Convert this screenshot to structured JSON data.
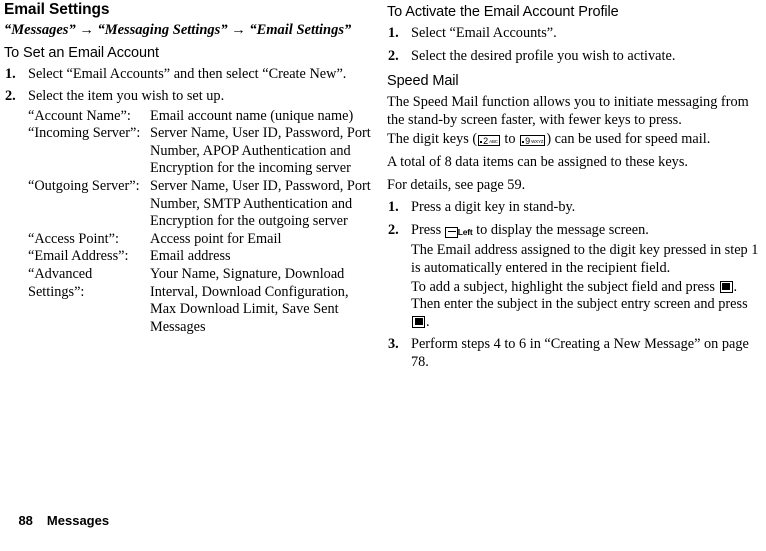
{
  "left_column": {
    "page_title": "Email Settings",
    "breadcrumb": "“Messages” → “Messaging Settings” → “Email Settings”",
    "section_heading": "To Set an Email Account",
    "steps": [
      {
        "num": "1.",
        "text": "Select “Email Accounts” and then select “Create New”."
      },
      {
        "num": "2.",
        "text": "Select the item you wish to set up."
      }
    ],
    "definitions": [
      {
        "term": "“Account Name”:",
        "desc": "Email account name (unique name)"
      },
      {
        "term": "“Incoming Server”:",
        "desc": "Server Name, User ID, Password, Port Number, APOP Authentication and Encryption for the incoming server"
      },
      {
        "term": "“Outgoing Server”:",
        "desc": "Server Name, User ID, Password, Port Number, SMTP Authentication and Encryption for the outgoing server"
      },
      {
        "term": "“Access Point”:",
        "desc": "Access point for Email"
      },
      {
        "term": "“Email Address”:",
        "desc": "Email address"
      },
      {
        "term": "“Advanced Settings”:",
        "desc": "Your Name, Signature, Download Interval, Download Configuration, Max Download Limit, Save Sent Messages"
      }
    ]
  },
  "right_column": {
    "section_heading": "To Activate the Email Account Profile",
    "activate_steps": [
      {
        "num": "1.",
        "text": "Select “Email Accounts”."
      },
      {
        "num": "2.",
        "text": "Select the desired profile you wish to activate."
      }
    ],
    "speed_mail_heading": "Speed Mail",
    "speed_mail_intro": "The Speed Mail function allows you to initiate messaging from the stand-by screen faster, with fewer keys to press.",
    "digit_keys_line": {
      "before": "The digit keys (",
      "key_from_digit": "2",
      "key_from_sub": "ABC",
      "between": " to ",
      "key_to_digit": "9",
      "key_to_sub": "WXYZ",
      "after": ") can be used for speed mail."
    },
    "total_items_line": "A total of 8 data items can be assigned to these keys.",
    "details_line": "For details, see page 59.",
    "speed_steps": [
      {
        "num": "1.",
        "text": "Press a digit key in stand-by."
      }
    ],
    "step2": {
      "num": "2.",
      "before": "Press ",
      "softkey_label": "Left",
      "after": " to display the message screen."
    },
    "step2_sub_a": "The Email address assigned to the digit key pressed in step 1 is automatically entered in the recipient field.",
    "step2_sub_b": {
      "part1": "To add a subject, highlight the subject field and press ",
      "part2": ". Then enter the subject in the subject entry screen and press ",
      "part3": "."
    },
    "step3": {
      "num": "3.",
      "text": "Perform steps 4 to 6 in “Creating a New Message” on page 78."
    }
  },
  "footer": {
    "page_number": "88",
    "chapter": "Messages"
  }
}
